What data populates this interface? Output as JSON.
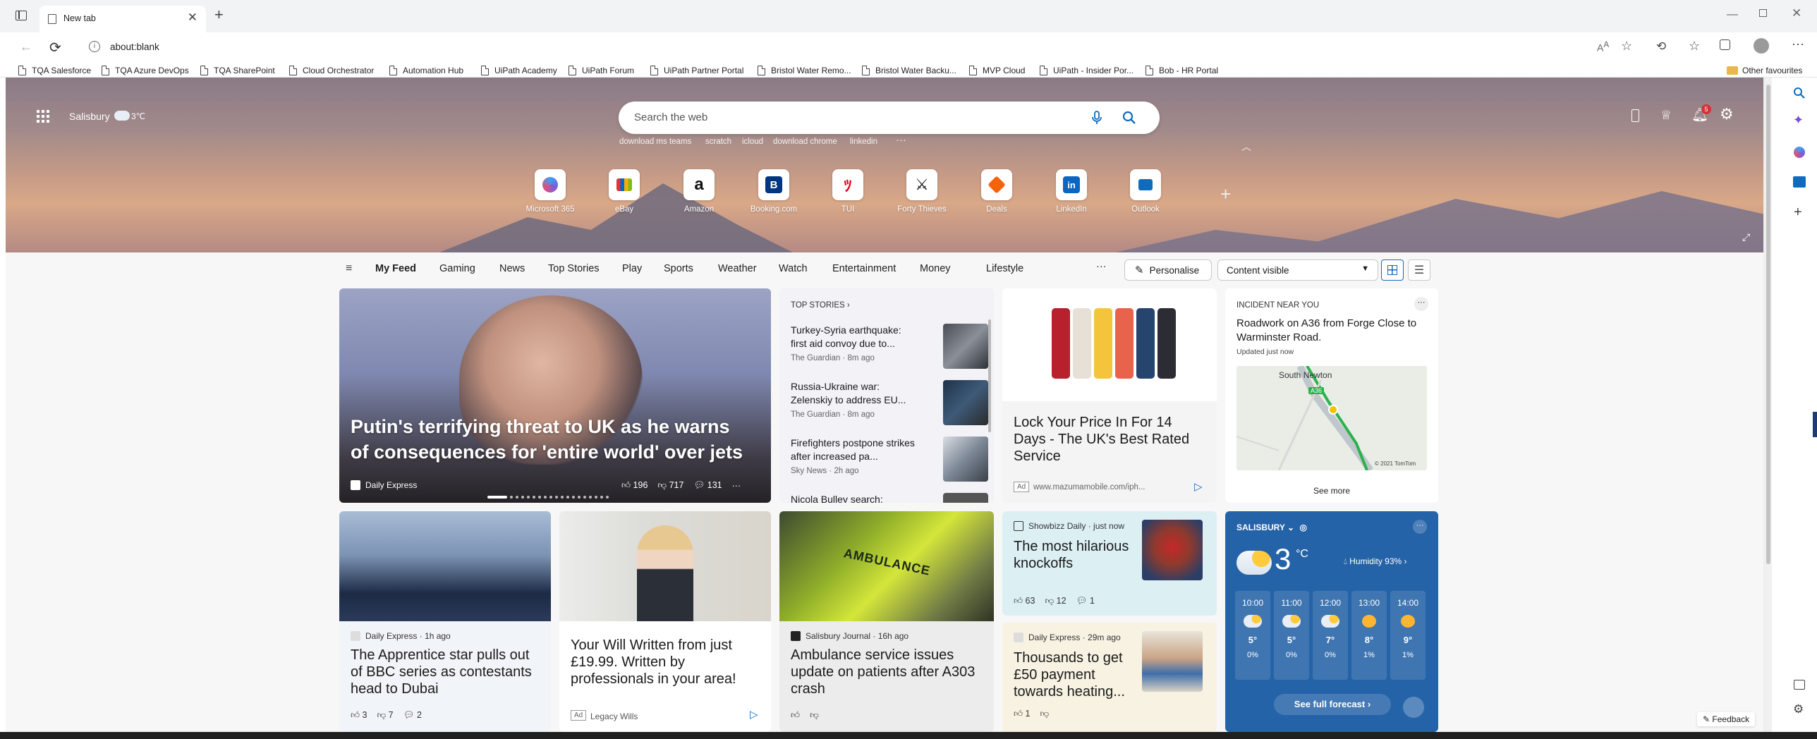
{
  "browser": {
    "tab_title": "New tab",
    "address": "about:blank",
    "favorites": [
      "TQA Salesforce",
      "TQA Azure DevOps",
      "TQA SharePoint",
      "Cloud Orchestrator",
      "Automation Hub",
      "UiPath Academy",
      "UiPath Forum",
      "UiPath Partner Portal",
      "Bristol Water Remo...",
      "Bristol Water Backu...",
      "MVP Cloud",
      "UiPath - Insider Por...",
      "Bob - HR Portal"
    ],
    "other_favourites": "Other favourites"
  },
  "header": {
    "location": "Salisbury",
    "temp": "3℃",
    "notif_count": "5",
    "search_placeholder": "Search the web",
    "trending": [
      "download ms teams",
      "scratch",
      "icloud",
      "download chrome",
      "linkedin"
    ]
  },
  "quicklinks": [
    {
      "label": "Microsoft 365",
      "icon": "m365-icon"
    },
    {
      "label": "eBay",
      "icon": "ebay-icon"
    },
    {
      "label": "Amazon",
      "icon": "amazon-icon"
    },
    {
      "label": "Booking.com",
      "icon": "booking-icon"
    },
    {
      "label": "TUI",
      "icon": "tui-icon"
    },
    {
      "label": "Forty Thieves",
      "icon": "forty-thieves-icon"
    },
    {
      "label": "Deals",
      "icon": "deals-icon"
    },
    {
      "label": "LinkedIn",
      "icon": "linkedin-icon"
    },
    {
      "label": "Outlook",
      "icon": "outlook-icon"
    }
  ],
  "feed_nav": {
    "items": [
      "My Feed",
      "Gaming",
      "News",
      "Top Stories",
      "Play",
      "Sports",
      "Weather",
      "Watch",
      "Entertainment",
      "Money",
      "Lifestyle"
    ],
    "more": "···",
    "personalise": "Personalise",
    "content_select": "Content visible"
  },
  "hero_story": {
    "title": "Putin's terrifying threat to UK as he warns of consequences for 'entire world' over jets",
    "source": "Daily Express",
    "likes": "196",
    "dislikes": "717",
    "comments": "131"
  },
  "top_stories": {
    "heading": "TOP STORIES",
    "items": [
      {
        "title": "Turkey-Syria earthquake: first aid convoy due to...",
        "meta": "The Guardian · 8m ago"
      },
      {
        "title": "Russia-Ukraine war: Zelenskiy to address EU...",
        "meta": "The Guardian · 8m ago"
      },
      {
        "title": "Firefighters postpone strikes after increased pa...",
        "meta": "Sky News · 2h ago"
      },
      {
        "title": "Nicola Bulley search:",
        "meta": ""
      }
    ]
  },
  "ad_card": {
    "title": "Lock Your Price In For 14 Days - The UK's Best Rated Service",
    "ad_label": "Ad",
    "url": "www.mazumamobile.com/iph..."
  },
  "incident": {
    "heading": "INCIDENT NEAR YOU",
    "title": "Roadwork on A36 from Forge Close to Warminster Road.",
    "updated": "Updated just now",
    "map_place": "South Newton",
    "map_road": "A36",
    "map_credit": "© 2021 TomTom",
    "see_more": "See more"
  },
  "row2": {
    "apprentice": {
      "source": "Daily Express · 1h ago",
      "title": "The Apprentice star pulls out of BBC series as contestants head to Dubai",
      "likes": "3",
      "dislikes": "7",
      "comments": "2"
    },
    "will": {
      "title": "Your Will Written from just £19.99. Written by professionals in your area!",
      "ad_label": "Ad",
      "source": "Legacy Wills"
    },
    "ambulance": {
      "source": "Salisbury Journal · 16h ago",
      "title": "Ambulance service issues update on patients after A303 crash",
      "van_text": "AMBULANCE"
    },
    "knockoffs": {
      "source": "Showbizz Daily · just now",
      "title": "The most hilarious knockoffs",
      "likes": "63",
      "dislikes": "12",
      "comments": "1"
    },
    "payment": {
      "source": "Daily Express · 29m ago",
      "title": "Thousands to get £50 payment towards heating...",
      "likes": "1"
    }
  },
  "weather": {
    "location": "SALISBURY",
    "temp": "3",
    "unit": "°C",
    "humidity": "Humidity 93%",
    "hours": [
      {
        "time": "10:00",
        "temp": "5°",
        "precip": "0%"
      },
      {
        "time": "11:00",
        "temp": "5°",
        "precip": "0%"
      },
      {
        "time": "12:00",
        "temp": "7°",
        "precip": "0%"
      },
      {
        "time": "13:00",
        "temp": "8°",
        "precip": "1%"
      },
      {
        "time": "14:00",
        "temp": "9°",
        "precip": "1%"
      }
    ],
    "forecast_link": "See full forecast"
  },
  "feedback": "Feedback",
  "colors": {
    "accent": "#0f6cbd",
    "weather_bg": "#2563a8",
    "notif": "#d13438"
  }
}
